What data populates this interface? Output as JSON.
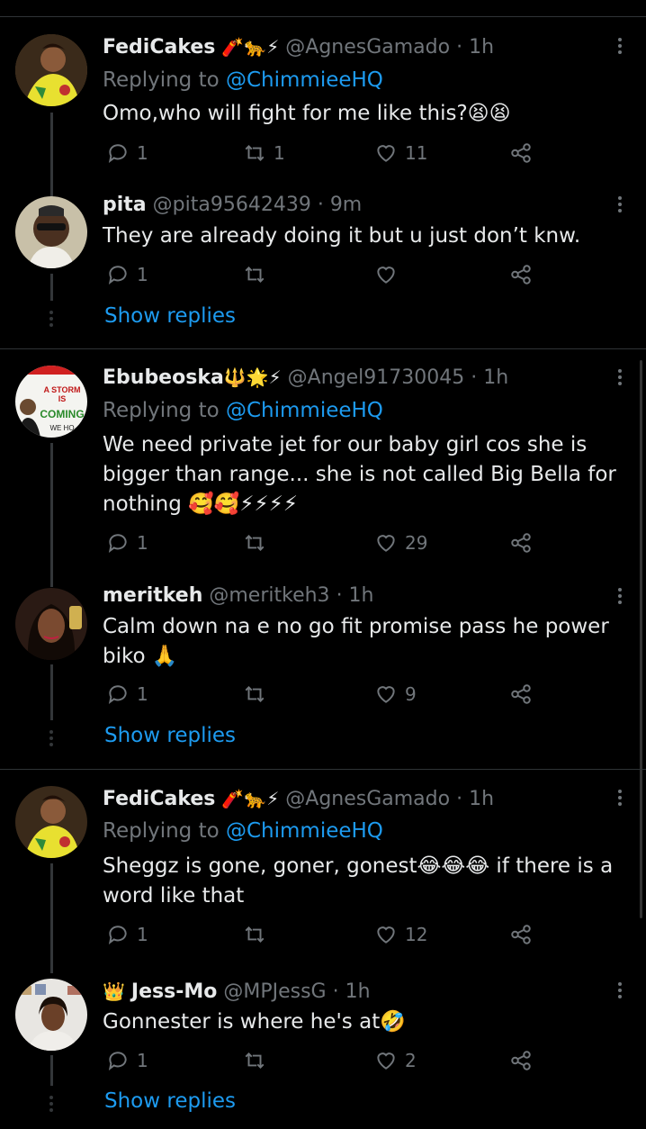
{
  "tweets": [
    {
      "name": "FediCakes",
      "name_emoji": "🧨🐆⚡",
      "handle": "@AgnesGamado",
      "time": "· 1h",
      "replying_label": "Replying to ",
      "replying_to": "@ChimmieeHQ",
      "text": "Omo,who will fight for me like this?😫😫",
      "replies": "1",
      "retweets": "1",
      "likes": "11"
    },
    {
      "name": "pita",
      "name_emoji": "",
      "handle": "@pita95642439",
      "time": "· 9m",
      "text": "They are already doing it but u just don’t knw.",
      "replies": "1",
      "retweets": "",
      "likes": "",
      "show_replies": "Show replies"
    },
    {
      "name": "Ebubeoska",
      "name_emoji": "🔱🌟⚡",
      "handle": "@Angel91730045",
      "time": "· 1h",
      "replying_label": "Replying to ",
      "replying_to": "@ChimmieeHQ",
      "text": "We need private jet for our baby girl cos she is bigger than range... she is not called Big Bella for nothing 🥰🥰⚡⚡⚡⚡",
      "replies": "1",
      "retweets": "",
      "likes": "29",
      "avatar_text": [
        "A STORM",
        "IS",
        "COMING",
        "WE HO"
      ]
    },
    {
      "name": "meritkeh",
      "name_emoji": "",
      "handle": "@meritkeh3",
      "time": "· 1h",
      "text": "Calm down na e no go fit promise pass he power biko 🙏",
      "replies": "1",
      "retweets": "",
      "likes": "9",
      "show_replies": "Show replies"
    },
    {
      "name": "FediCakes",
      "name_emoji": "🧨🐆⚡",
      "handle": "@AgnesGamado",
      "time": "· 1h",
      "replying_label": "Replying to ",
      "replying_to": "@ChimmieeHQ",
      "text": "Sheggz is gone, goner, gonest😂😂😂 if there is a word like that",
      "replies": "1",
      "retweets": "",
      "likes": "12"
    },
    {
      "name": "Jess-Mo",
      "name_prefix_emoji": "👑",
      "name_emoji": "",
      "handle": "@MPJessG",
      "time": "· 1h",
      "text": "Gonnester is where he's at🤣",
      "replies": "1",
      "retweets": "",
      "likes": "2",
      "show_replies": "Show replies"
    }
  ],
  "colors": {
    "background": "#000000",
    "link": "#1d9bf0",
    "muted": "#71767b",
    "text": "#e7e9ea"
  }
}
